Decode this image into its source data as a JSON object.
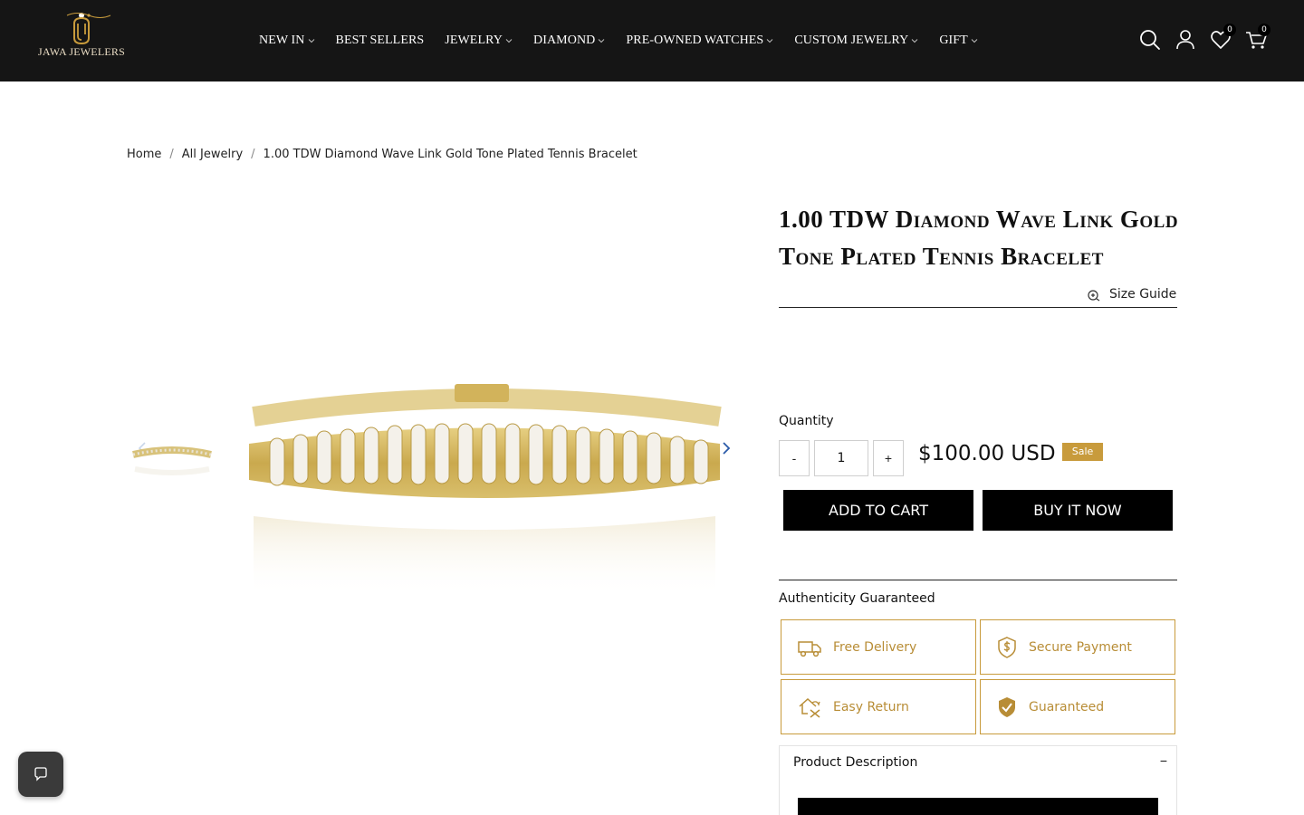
{
  "brand": {
    "name": "JAWA JEWELERS",
    "logo_icon": "ring-logo-icon",
    "accent": "#c89b3c"
  },
  "nav": [
    {
      "label": "NEW IN",
      "dropdown": true
    },
    {
      "label": "BEST SELLERS",
      "dropdown": false
    },
    {
      "label": "JEWELRY",
      "dropdown": true
    },
    {
      "label": "DIAMOND",
      "dropdown": true
    },
    {
      "label": "PRE-OWNED WATCHES",
      "dropdown": true
    },
    {
      "label": "CUSTOM JEWELRY",
      "dropdown": true
    },
    {
      "label": "GIFT",
      "dropdown": true
    }
  ],
  "header_icons": {
    "search": "search-icon",
    "account": "user-icon",
    "wishlist": "heart-icon",
    "wishlist_count": "0",
    "cart": "cart-icon",
    "cart_count": "0"
  },
  "breadcrumb": {
    "home": "Home",
    "category": "All Jewelry",
    "current": "1.00 TDW Diamond Wave Link Gold Tone Plated Tennis Bracelet"
  },
  "product": {
    "title": "1.00 TDW Diamond Wave Link Gold Tone Plated Tennis Bracelet",
    "size_guide": "Size Guide",
    "quantity_label": "Quantity",
    "quantity_value": "1",
    "decrement": "-",
    "increment": "+",
    "price": "$100.00 USD",
    "sale_badge": "Sale",
    "add_to_cart": "ADD TO CART",
    "buy_now": "BUY IT NOW"
  },
  "authenticity": {
    "title": "Authenticity Guaranteed",
    "features": [
      {
        "label": "Free Delivery",
        "icon": "delivery-truck-icon"
      },
      {
        "label": "Secure Payment",
        "icon": "shield-dollar-icon"
      },
      {
        "label": "Easy Return",
        "icon": "return-icon"
      },
      {
        "label": "Guaranteed",
        "icon": "badge-check-icon"
      }
    ]
  },
  "description": {
    "title": "Product Description",
    "toggle": "−"
  },
  "chat": {
    "icon": "chat-bubble-icon"
  }
}
